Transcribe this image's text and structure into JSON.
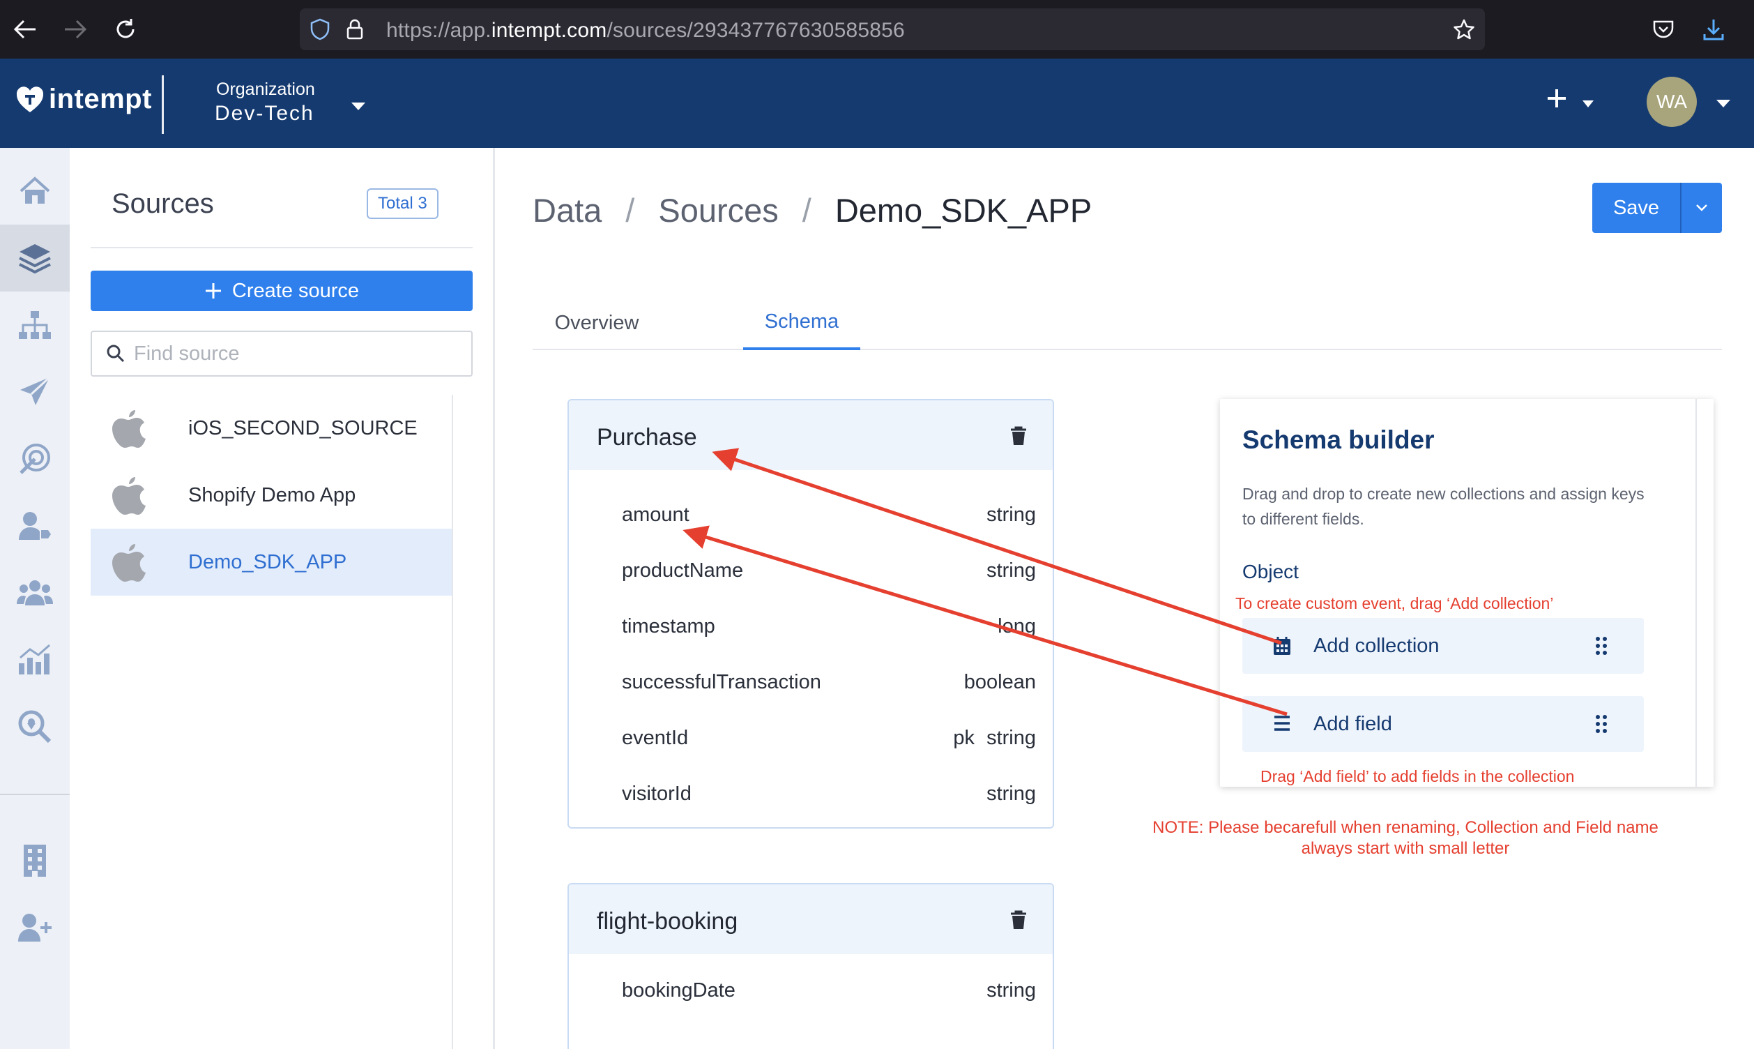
{
  "browser": {
    "url_prefix": "https://app.",
    "url_host": "intempt.com",
    "url_path": "/sources/293437767630585856"
  },
  "header": {
    "logo_text": "intempt",
    "org_label": "Organization",
    "org_name": "Dev-Tech",
    "avatar_initials": "WA"
  },
  "sources_panel": {
    "title": "Sources",
    "total_badge": "Total 3",
    "create_button": "Create source",
    "search_placeholder": "Find source",
    "items": [
      {
        "label": "iOS_SECOND_SOURCE",
        "icon": "apple-icon"
      },
      {
        "label": "Shopify Demo App",
        "icon": "apple-icon"
      },
      {
        "label": "Demo_SDK_APP",
        "icon": "apple-icon",
        "selected": true
      }
    ]
  },
  "main": {
    "breadcrumb": [
      "Data",
      "Sources",
      "Demo_SDK_APP"
    ],
    "breadcrumb_separator": "/",
    "save_button": "Save",
    "tabs": [
      {
        "label": "Overview",
        "active": false
      },
      {
        "label": "Schema",
        "active": true
      }
    ]
  },
  "collections": [
    {
      "name": "Purchase",
      "fields": [
        {
          "name": "amount",
          "pk": "",
          "type": "string"
        },
        {
          "name": "productName",
          "pk": "",
          "type": "string"
        },
        {
          "name": "timestamp",
          "pk": "",
          "type": "long"
        },
        {
          "name": "successfulTransaction",
          "pk": "",
          "type": "boolean"
        },
        {
          "name": "eventId",
          "pk": "pk",
          "type": "string"
        },
        {
          "name": "visitorId",
          "pk": "",
          "type": "string"
        }
      ]
    },
    {
      "name": "flight-booking",
      "fields": [
        {
          "name": "bookingDate",
          "pk": "",
          "type": "string"
        }
      ]
    }
  ],
  "schema_builder": {
    "title": "Schema builder",
    "description": "Drag and drop to create new collections and assign keys to different fields.",
    "object_label": "Object",
    "hint_collection": "To create custom event, drag ‘Add collection’",
    "add_collection": "Add collection",
    "add_field": "Add field",
    "hint_field": "Drag ‘Add field’ to add fields in the collection"
  },
  "note": "NOTE: Please becarefull when renaming, Collection and Field name always start with small letter",
  "colors": {
    "header_bg": "#153a70",
    "primary": "#2f80ed",
    "annotation": "#e53f2f"
  }
}
